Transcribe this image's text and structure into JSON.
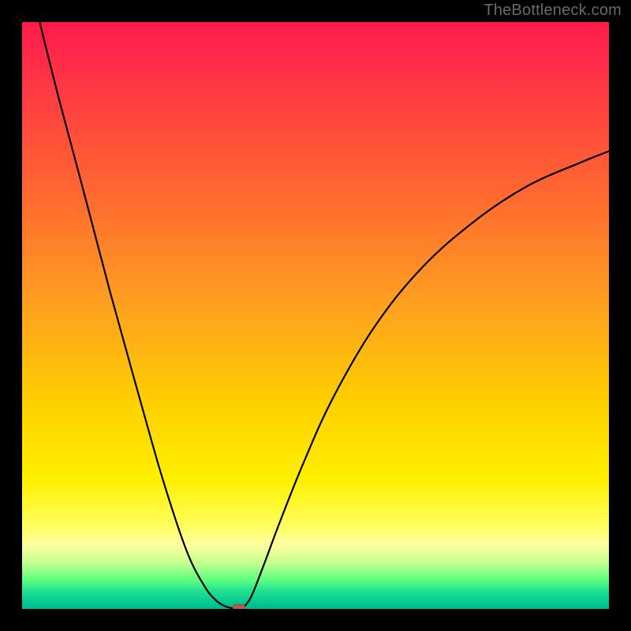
{
  "watermark": "TheBottleneck.com",
  "chart_data": {
    "type": "line",
    "title": "",
    "xlabel": "",
    "ylabel": "",
    "xlim": [
      0,
      100
    ],
    "ylim": [
      0,
      100
    ],
    "grid": false,
    "legend": false,
    "series": [
      {
        "name": "left-branch",
        "x": [
          3,
          6,
          10,
          15,
          20,
          24,
          28,
          31,
          33,
          34.5,
          35.5,
          36.5
        ],
        "y": [
          100,
          88,
          73,
          54,
          36,
          22,
          10,
          4,
          1.5,
          0.5,
          0.2,
          0.0
        ]
      },
      {
        "name": "right-branch",
        "x": [
          37.5,
          39,
          41,
          44,
          48,
          53,
          60,
          68,
          77,
          86,
          95,
          100
        ],
        "y": [
          0.0,
          2,
          7,
          15,
          25,
          36,
          48,
          58,
          66,
          72,
          76,
          78
        ]
      }
    ],
    "marker": {
      "x": 37,
      "y": 0
    },
    "marker_color": "#b85a4a",
    "background_gradient": {
      "type": "vertical",
      "stops": [
        {
          "pct": 0,
          "color": "#ff1a4a"
        },
        {
          "pct": 30,
          "color": "#ff6a30"
        },
        {
          "pct": 65,
          "color": "#ffd000"
        },
        {
          "pct": 88,
          "color": "#ffff80"
        },
        {
          "pct": 95,
          "color": "#60ff80"
        },
        {
          "pct": 100,
          "color": "#00b890"
        }
      ]
    }
  }
}
